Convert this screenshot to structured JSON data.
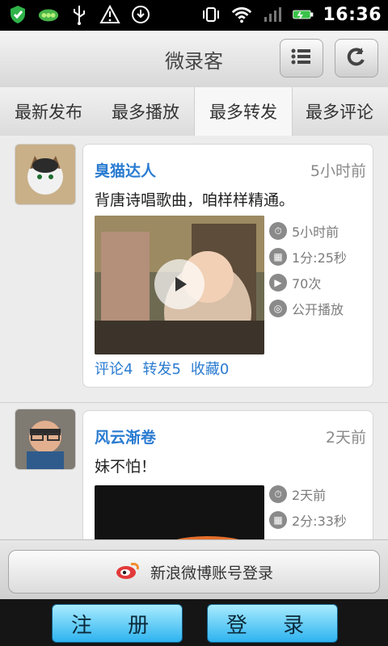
{
  "statusbar": {
    "time": "16:36"
  },
  "app": {
    "title": "微录客"
  },
  "tabs": [
    {
      "label": "最新发布"
    },
    {
      "label": "最多播放"
    },
    {
      "label": "最多转发",
      "active": true
    },
    {
      "label": "最多评论"
    }
  ],
  "posts": [
    {
      "username": "臭猫达人",
      "time": "5小时前",
      "text": "背唐诗唱歌曲，咱样样精通。",
      "meta": {
        "time": "5小时前",
        "duration": "1分:25秒",
        "plays": "70次",
        "visibility": "公开播放"
      },
      "actions": {
        "comments": "评论4",
        "reposts": "转发5",
        "favorites": "收藏0"
      }
    },
    {
      "username": "风云渐卷",
      "time": "2天前",
      "text": "妹不怕！",
      "meta": {
        "time": "2天前",
        "duration": "2分:33秒"
      }
    }
  ],
  "weibo_login": {
    "label": "新浪微博账号登录"
  },
  "bottom": {
    "register": "注 册",
    "login": "登 录"
  },
  "colors": {
    "link": "#2a7bd1",
    "primary_button": "#2db3ef"
  }
}
